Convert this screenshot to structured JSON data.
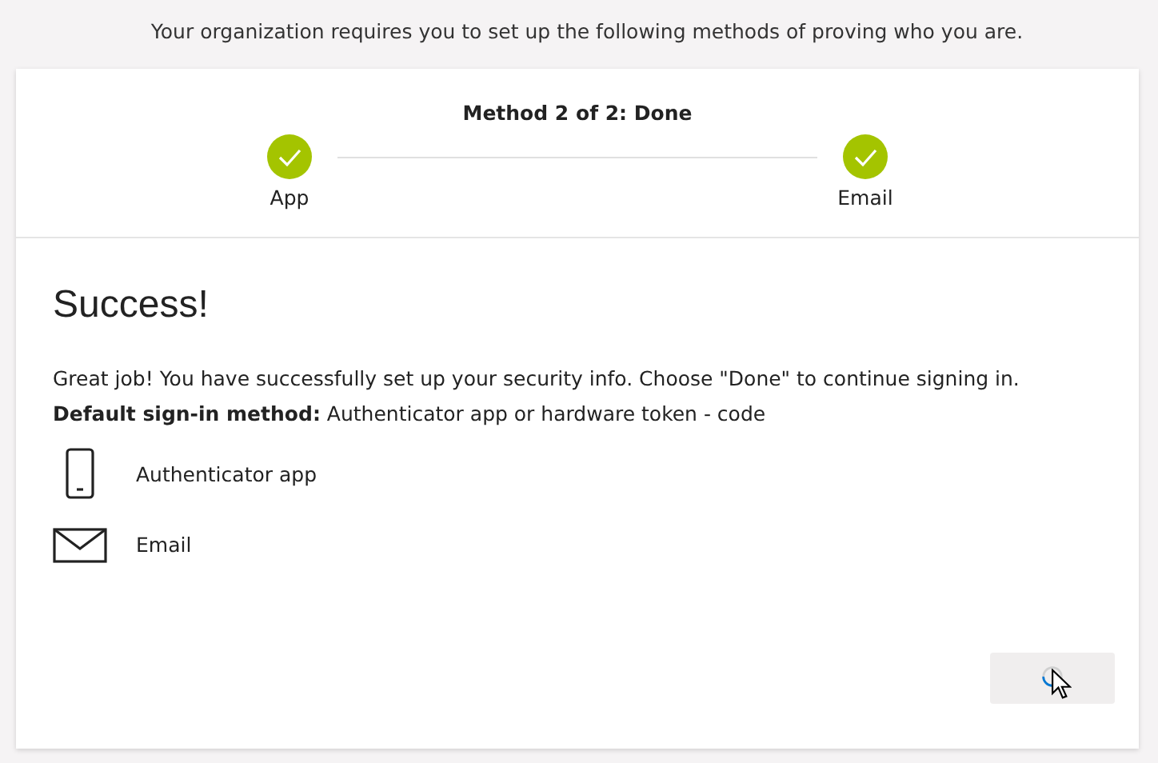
{
  "intro": "Your organization requires you to set up the following methods of proving who you are.",
  "progress": {
    "title": "Method 2 of 2: Done",
    "steps": [
      {
        "label": "App",
        "done": true
      },
      {
        "label": "Email",
        "done": true
      }
    ]
  },
  "heading": "Success!",
  "message": "Great job! You have successfully set up your security info. Choose \"Done\" to continue signing in.",
  "default_method": "**Default sign-in method:** Authenticator app or hardware token - code",
  "methods": [
    {
      "kind": "phone",
      "label": "Authenticator app"
    },
    {
      "kind": "email",
      "label": "Email"
    }
  ],
  "done_button": {
    "loading": true
  }
}
